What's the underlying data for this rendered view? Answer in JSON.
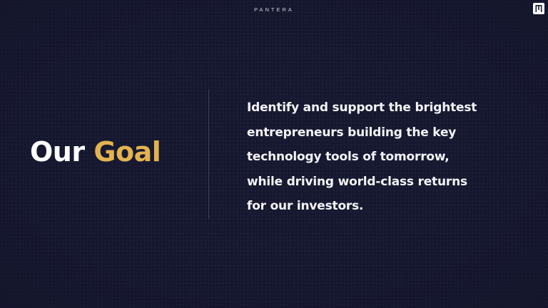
{
  "slide": {
    "brand": "PANTERA",
    "corner_logo_icon": "pantera-mark-icon",
    "heading": {
      "word1": "Our",
      "word2": "Goal"
    },
    "statement_lines": [
      "Identify and support the brightest",
      "entrepreneurs building the key",
      "technology tools of tomorrow,",
      "while driving world-class returns",
      "for our investors."
    ]
  },
  "colors": {
    "background": "#161830",
    "accent_gold": "#e3b34f",
    "text": "#ffffff",
    "divider": "#3e4058"
  }
}
